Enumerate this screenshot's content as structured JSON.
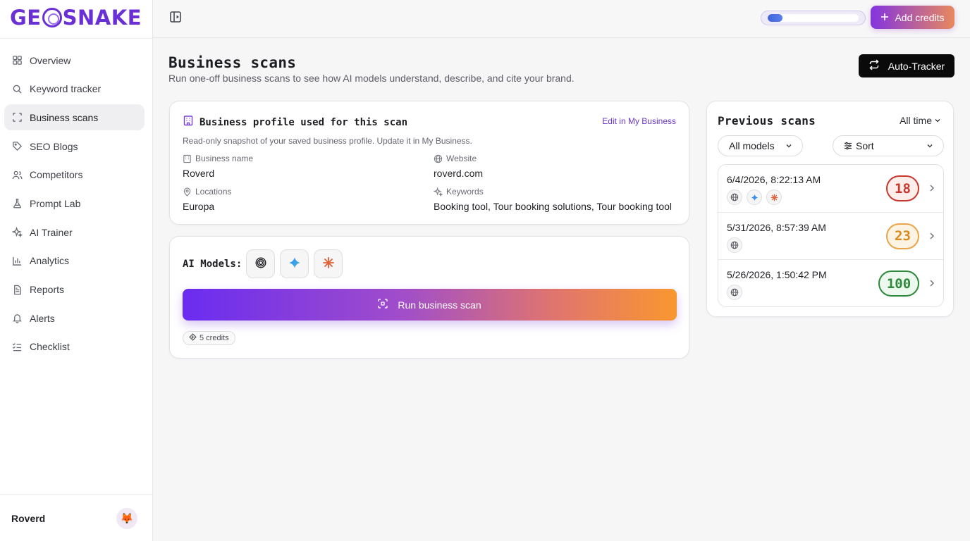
{
  "brand": {
    "logo_text_left": "GE",
    "logo_text_right": "SNAKE"
  },
  "nav": {
    "items": [
      {
        "label": "Overview",
        "icon": "grid-icon",
        "active": false
      },
      {
        "label": "Keyword tracker",
        "icon": "search-icon",
        "active": false
      },
      {
        "label": "Business scans",
        "icon": "scan-icon",
        "active": true
      },
      {
        "label": "SEO Blogs",
        "icon": "tag-icon",
        "active": false
      },
      {
        "label": "Competitors",
        "icon": "users-icon",
        "active": false
      },
      {
        "label": "Prompt Lab",
        "icon": "flask-icon",
        "active": false
      },
      {
        "label": "AI Trainer",
        "icon": "sparkle-icon",
        "active": false
      },
      {
        "label": "Analytics",
        "icon": "bar-chart-icon",
        "active": false
      },
      {
        "label": "Reports",
        "icon": "document-icon",
        "active": false
      },
      {
        "label": "Alerts",
        "icon": "bell-icon",
        "active": false
      },
      {
        "label": "Checklist",
        "icon": "checklist-icon",
        "active": false
      }
    ],
    "user": {
      "name": "Roverd",
      "avatar_emoji": "🦊"
    }
  },
  "topbar": {
    "credits_fraction": 0.16,
    "add_credits_label": "Add credits"
  },
  "header": {
    "title": "Business scans",
    "subtitle": "Run one-off business scans to see how AI models understand, describe, and cite your brand.",
    "auto_tracker_label": "Auto-Tracker"
  },
  "profile": {
    "title": "Business profile used for this scan",
    "edit_label": "Edit in My Business",
    "note": "Read-only snapshot of your saved business profile. Update it in My Business.",
    "fields": {
      "business_name": {
        "label": "Business name",
        "value": "Roverd"
      },
      "website": {
        "label": "Website",
        "value": "roverd.com"
      },
      "locations": {
        "label": "Locations",
        "value": "Europa"
      },
      "keywords": {
        "label": "Keywords",
        "value": "Booking tool, Tour booking solutions, Tour booking tool"
      }
    }
  },
  "models": {
    "label": "AI Models:",
    "run_label": "Run business scan",
    "credits_label": "5 credits"
  },
  "previous": {
    "title": "Previous scans",
    "range_label": "All time",
    "models_filter": "All models",
    "sort_label": "Sort",
    "scans": [
      {
        "date": "6/4/2026, 8:22:13 AM",
        "score": "18",
        "models": [
          "globe-icon",
          "gemini-icon",
          "claude-icon"
        ],
        "color": "#c8372d",
        "bg": "#fdeeec"
      },
      {
        "date": "5/31/2026, 8:57:39 AM",
        "score": "23",
        "models": [
          "globe-icon"
        ],
        "color": "#d98a1f",
        "bg": "#fdf3e3"
      },
      {
        "date": "5/26/2026, 1:50:42 PM",
        "score": "100",
        "models": [
          "globe-icon"
        ],
        "color": "#2d8a3a",
        "bg": "#edf8ee"
      }
    ]
  },
  "colors": {
    "brand": "#6b2fd6",
    "accent_orange": "#f9972f",
    "dark_button": "#0a0a0b"
  }
}
